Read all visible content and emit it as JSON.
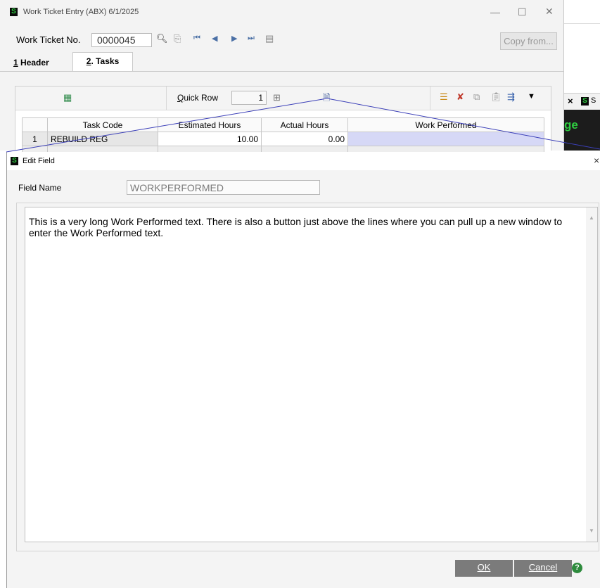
{
  "main_window": {
    "title": "Work Ticket Entry (ABX) 6/1/2025",
    "work_ticket_label": "Work Ticket No.",
    "work_ticket_value": "0000045",
    "copy_from_button": "Copy from...",
    "tabs": [
      {
        "label": "1 Header",
        "key": "1",
        "rest": " Header"
      },
      {
        "label": "2. Tasks",
        "key": "2",
        "rest": ". Tasks"
      }
    ],
    "quick_row_label": "Quick Row",
    "quick_row_value": "1",
    "grid": {
      "columns": [
        "",
        "Task Code",
        "Estimated Hours",
        "Actual Hours",
        "Work Performed"
      ],
      "rows": [
        {
          "num": "1",
          "task_code": "REBUILD REG",
          "estimated_hours": "10.00",
          "actual_hours": "0.00",
          "work_performed": ""
        }
      ]
    }
  },
  "right_window": {
    "close_label": "×",
    "tab_text": "S",
    "partial_text": "ge"
  },
  "dialog": {
    "title": "Edit Field",
    "close_label": "×",
    "field_name_label": "Field Name",
    "field_name_value": "WORKPERFORMED",
    "text": "This is a very long Work Performed text. There is also a button just above the lines where you can pull up a new window to enter the Work Performed text.",
    "ok_button": "OK",
    "cancel_button": "Cancel"
  },
  "colors": {
    "app_background": "#f3f3f3",
    "dialog_button": "#7b7b7b",
    "selected_cell": "#d6d8f6",
    "callout_line": "#3b3fb8",
    "help_icon": "#2e8b3d"
  },
  "icons": [
    "sage-logo-icon",
    "search-icon",
    "lookup-icon",
    "first-record-icon",
    "previous-record-icon",
    "next-record-icon",
    "last-record-icon",
    "delete-icon",
    "grid-settings-icon",
    "quick-row-icon",
    "edit-text-icon",
    "insert-row-icon",
    "delete-row-icon",
    "copy-row-icon",
    "paste-row-icon",
    "more-options-icon",
    "help-icon"
  ]
}
